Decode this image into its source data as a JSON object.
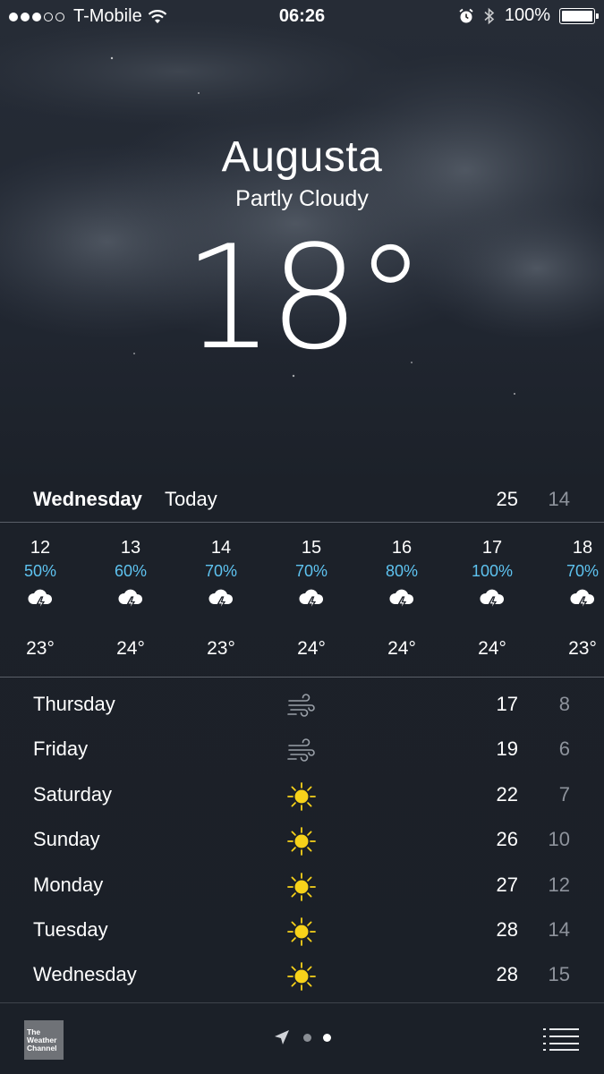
{
  "status_bar": {
    "carrier": "T-Mobile",
    "signal_full": 3,
    "signal_empty": 2,
    "time": "06:26",
    "battery": "100%",
    "battery_level": 1.0
  },
  "location": {
    "city": "Augusta",
    "condition": "Partly Cloudy",
    "temperature": "18°"
  },
  "today": {
    "day": "Wednesday",
    "label": "Today",
    "high": "25",
    "low": "14"
  },
  "hourly": [
    {
      "hour": "12",
      "precip": "50%",
      "icon": "thunderstorm-icon",
      "temp": "23°"
    },
    {
      "hour": "13",
      "precip": "60%",
      "icon": "thunderstorm-icon",
      "temp": "24°"
    },
    {
      "hour": "14",
      "precip": "70%",
      "icon": "thunderstorm-icon",
      "temp": "23°"
    },
    {
      "hour": "15",
      "precip": "70%",
      "icon": "thunderstorm-icon",
      "temp": "24°"
    },
    {
      "hour": "16",
      "precip": "80%",
      "icon": "thunderstorm-icon",
      "temp": "24°"
    },
    {
      "hour": "17",
      "precip": "100%",
      "icon": "thunderstorm-icon",
      "temp": "24°"
    },
    {
      "hour": "18",
      "precip": "70%",
      "icon": "thunderstorm-icon",
      "temp": "23°"
    }
  ],
  "daily": [
    {
      "day": "Thursday",
      "icon": "wind-icon",
      "high": "17",
      "low": "8"
    },
    {
      "day": "Friday",
      "icon": "wind-icon",
      "high": "19",
      "low": "6"
    },
    {
      "day": "Saturday",
      "icon": "sun-icon",
      "high": "22",
      "low": "7"
    },
    {
      "day": "Sunday",
      "icon": "sun-icon",
      "high": "26",
      "low": "10"
    },
    {
      "day": "Monday",
      "icon": "sun-icon",
      "high": "27",
      "low": "12"
    },
    {
      "day": "Tuesday",
      "icon": "sun-icon",
      "high": "28",
      "low": "14"
    },
    {
      "day": "Wednesday",
      "icon": "sun-icon",
      "high": "28",
      "low": "15"
    }
  ],
  "bottom_bar": {
    "logo_text": [
      "The",
      "Weather",
      "Channel"
    ],
    "pages": 2,
    "current_page": 2
  },
  "colors": {
    "precip": "#5ec3f0",
    "sun": "#f7d21a",
    "low_temp": "#8e939c"
  }
}
